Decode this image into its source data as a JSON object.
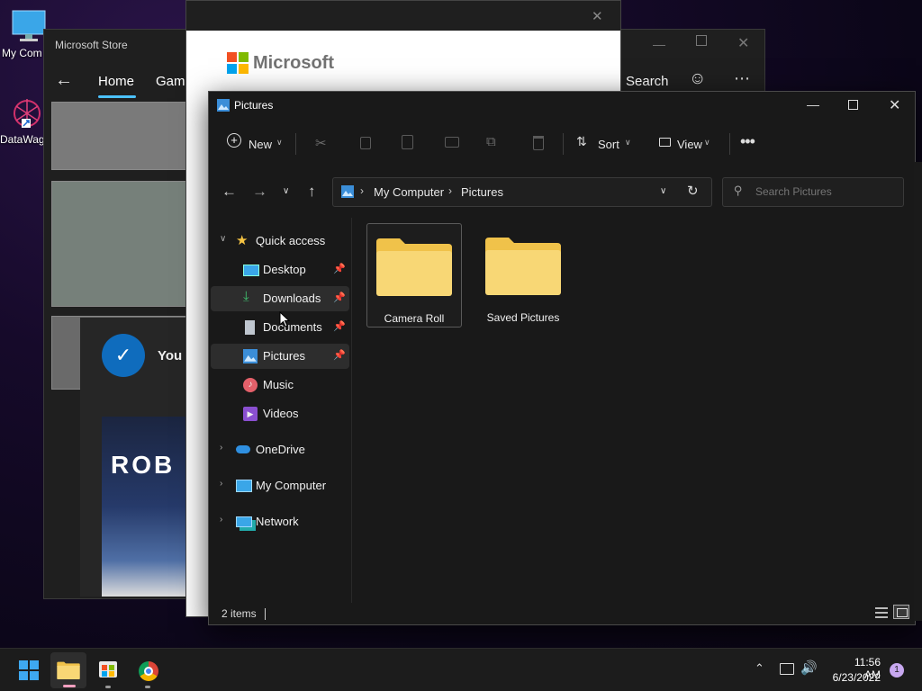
{
  "desktop": {
    "icons": [
      {
        "label": "My Com",
        "icon": "computer-icon"
      },
      {
        "label": "DataWag",
        "icon": "app-shortcut-icon"
      }
    ]
  },
  "store": {
    "title": "Microsoft Store",
    "tabs": [
      "Home",
      "Gami"
    ],
    "search_label": "Search",
    "toast_text": "You c",
    "game_text": "ROB"
  },
  "ms_login": {
    "brand": "Microsoft"
  },
  "explorer": {
    "title": "Pictures",
    "toolbar": {
      "new_label": "New",
      "sort_label": "Sort",
      "view_label": "View"
    },
    "breadcrumb": [
      "My Computer",
      "Pictures"
    ],
    "search_placeholder": "Search Pictures",
    "nav": {
      "quick_access": "Quick access",
      "items": [
        {
          "label": "Desktop",
          "icon": "desktop-icon",
          "pinned": true
        },
        {
          "label": "Downloads",
          "icon": "download-icon",
          "pinned": true
        },
        {
          "label": "Documents",
          "icon": "document-icon",
          "pinned": true
        },
        {
          "label": "Pictures",
          "icon": "pictures-icon",
          "pinned": true
        },
        {
          "label": "Music",
          "icon": "music-icon",
          "pinned": false
        },
        {
          "label": "Videos",
          "icon": "videos-icon",
          "pinned": false
        }
      ],
      "roots": [
        {
          "label": "OneDrive",
          "icon": "cloud-icon"
        },
        {
          "label": "My Computer",
          "icon": "computer-icon"
        },
        {
          "label": "Network",
          "icon": "network-icon"
        }
      ]
    },
    "folders": [
      {
        "label": "Camera Roll"
      },
      {
        "label": "Saved Pictures"
      }
    ],
    "status": "2 items"
  },
  "taskbar": {
    "time": "11:56 AM",
    "date": "6/23/2022",
    "notification_count": "1"
  },
  "colors": {
    "accent": "#0067c0",
    "folder": "#f8d775",
    "folder_back": "#f0c24a",
    "selection": "#2d2d2d"
  }
}
